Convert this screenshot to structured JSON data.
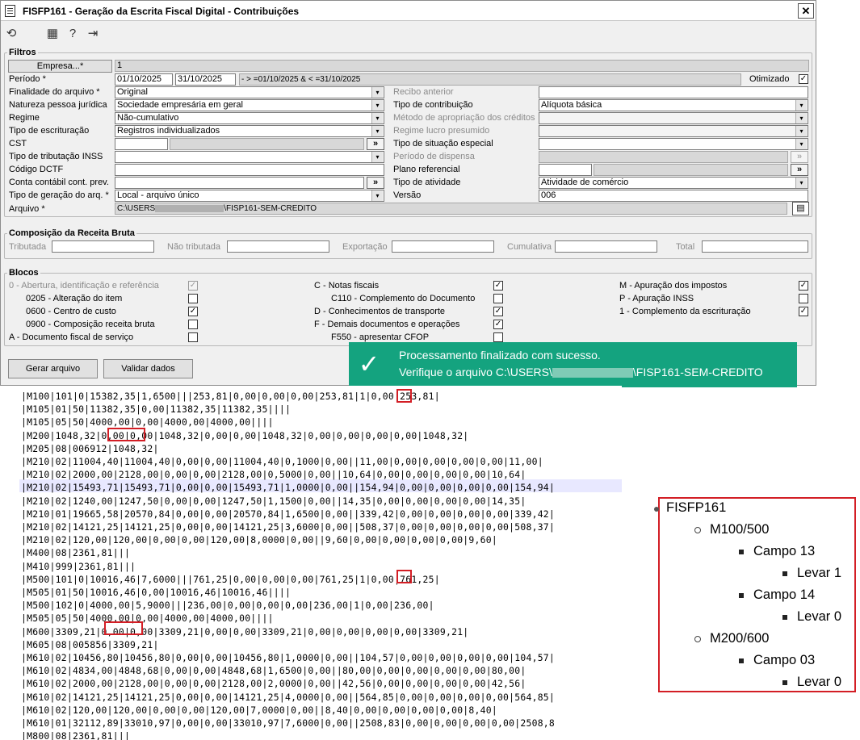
{
  "window": {
    "title": "FISFP161 - Geração da Escrita Fiscal Digital - Contribuições",
    "close": "✕"
  },
  "toolbar": {
    "icons": [
      "refresh-icon",
      "calendar-icon",
      "help-icon",
      "exit-icon"
    ]
  },
  "filtros": {
    "title": "Filtros",
    "empresa_button": "Empresa...*",
    "empresa_value": "1",
    "periodo_label": "Período *",
    "periodo_from": "01/10/2025",
    "periodo_to": "31/10/2025",
    "periodo_expr": "- > =01/10/2025 & < =31/10/2025",
    "otimizado_label": "Otimizado",
    "finalidade_label": "Finalidade do arquivo *",
    "finalidade_value": "Original",
    "natureza_label": "Natureza pessoa jurídica",
    "natureza_value": "Sociedade empresária em geral",
    "regime_label": "Regime",
    "regime_value": "Não-cumulativo",
    "escrituracao_label": "Tipo de escrituração",
    "escrituracao_value": "Registros individualizados",
    "cst_label": "CST",
    "tributacao_inss_label": "Tipo de tributação INSS",
    "dctf_label": "Código DCTF",
    "conta_label": "Conta contábil cont. prev.",
    "geracao_label": "Tipo de geração do arq. *",
    "geracao_value": "Local - arquivo único",
    "arquivo_label": "Arquivo *",
    "arquivo_value_a": "C:\\USERS",
    "arquivo_value_b": "\\FISP161-SEM-CREDITO",
    "recibo_label": "Recibo anterior",
    "contribuicao_label": "Tipo de contribuição",
    "contribuicao_value": "Alíquota básica",
    "apropriacao_label": "Método de apropriação dos créditos",
    "lucro_label": "Regime lucro presumido",
    "situacao_label": "Tipo de situação especial",
    "dispensa_label": "Período de dispensa",
    "plano_label": "Plano referencial",
    "atividade_label": "Tipo de atividade",
    "atividade_value": "Atividade de comércio",
    "versao_label": "Versão",
    "versao_value": "006",
    "more_button": "»",
    "dropdown_arrow": "▾"
  },
  "receita": {
    "title": "Composição da Receita Bruta",
    "tributada": "Tributada",
    "nao_tributada": "Não tributada",
    "exportacao": "Exportação",
    "cumulativa": "Cumulativa",
    "total": "Total"
  },
  "blocos": {
    "title": "Blocos",
    "b0": "0 - Abertura, identificação e referência",
    "b0205": "0205 - Alteração do item",
    "b0600": "0600 - Centro de custo",
    "b0900": "0900 - Composição receita bruta",
    "bA": "A - Documento fiscal de serviço",
    "bC": "C - Notas fiscais",
    "bC110": "C110 - Complemento do Documento",
    "bD": "D - Conhecimentos de transporte",
    "bF": "F - Demais documentos e operações",
    "bF550": "F550 - apresentar CFOP",
    "bM": "M - Apuração dos impostos",
    "bP": "P - Apuração INSS",
    "b1": "1 - Complemento da escrituração",
    "check": "✓"
  },
  "actions": {
    "gerar": "Gerar arquivo",
    "validar": "Validar dados"
  },
  "toast": {
    "check": "✓",
    "line1": "Processamento finalizado com sucesso.",
    "line2a": "Verifique o arquivo C:\\USERS\\",
    "line2b": "\\FISP161-SEM-CREDITO"
  },
  "file_lines": [
    "|M100|101|0|15382,35|1,6500|||253,81|0,00|0,00|0,00|253,81|1|0,00|253,81|",
    "|M105|01|50|11382,35|0,00|11382,35|11382,35||||",
    "|M105|05|50|4000,00|0,00|4000,00|4000,00||||",
    "|M200|1048,32|0,00|0,00|1048,32|0,00|0,00|1048,32|0,00|0,00|0,00|0,00|1048,32|",
    "|M205|08|006912|1048,32|",
    "|M210|02|11004,40|11004,40|0,00|0,00|11004,40|0,1000|0,00||11,00|0,00|0,00|0,00|0,00|11,00|",
    "|M210|02|2000,00|2128,00|0,00|0,00|2128,00|0,5000|0,00||10,64|0,00|0,00|0,00|0,00|10,64|",
    "|M210|02|15493,71|15493,71|0,00|0,00|15493,71|1,0000|0,00||154,94|0,00|0,00|0,00|0,00|154,94|",
    "|M210|02|1240,00|1247,50|0,00|0,00|1247,50|1,1500|0,00||14,35|0,00|0,00|0,00|0,00|14,35|",
    "|M210|01|19665,58|20570,84|0,00|0,00|20570,84|1,6500|0,00||339,42|0,00|0,00|0,00|0,00|339,42|",
    "|M210|02|14121,25|14121,25|0,00|0,00|14121,25|3,6000|0,00||508,37|0,00|0,00|0,00|0,00|508,37|",
    "|M210|02|120,00|120,00|0,00|0,00|120,00|8,0000|0,00||9,60|0,00|0,00|0,00|0,00|9,60|",
    "|M400|08|2361,81|||",
    "|M410|999|2361,81|||",
    "|M500|101|0|10016,46|7,6000|||761,25|0,00|0,00|0,00|761,25|1|0,00|761,25|",
    "|M505|01|50|10016,46|0,00|10016,46|10016,46||||",
    "|M500|102|0|4000,00|5,9000|||236,00|0,00|0,00|0,00|236,00|1|0,00|236,00|",
    "|M505|05|50|4000,00|0,00|4000,00|4000,00||||",
    "|M600|3309,21|0,00|0,00|3309,21|0,00|0,00|3309,21|0,00|0,00|0,00|0,00|3309,21|",
    "|M605|08|005856|3309,21|",
    "|M610|02|10456,80|10456,80|0,00|0,00|10456,80|1,0000|0,00||104,57|0,00|0,00|0,00|0,00|104,57|",
    "|M610|02|4834,00|4848,68|0,00|0,00|4848,68|1,6500|0,00||80,00|0,00|0,00|0,00|0,00|80,00|",
    "|M610|02|2000,00|2128,00|0,00|0,00|2128,00|2,0000|0,00||42,56|0,00|0,00|0,00|0,00|42,56|",
    "|M610|02|14121,25|14121,25|0,00|0,00|14121,25|4,0000|0,00||564,85|0,00|0,00|0,00|0,00|564,85|",
    "|M610|02|120,00|120,00|0,00|0,00|120,00|7,0000|0,00||8,40|0,00|0,00|0,00|0,00|8,40|",
    "|M610|01|32112,89|33010,97|0,00|0,00|33010,97|7,6000|0,00||2508,83|0,00|0,00|0,00|0,00|2508,8",
    "|M800|08|2361,81|||"
  ],
  "tree": {
    "root": "FISFP161",
    "n1": "M100/500",
    "n1a": "Campo 13",
    "n1a1": "Levar 1",
    "n1b": "Campo 14",
    "n1b1": "Levar 0",
    "n2": "M200/600",
    "n2a": "Campo 03",
    "n2a1": "Levar 0"
  }
}
